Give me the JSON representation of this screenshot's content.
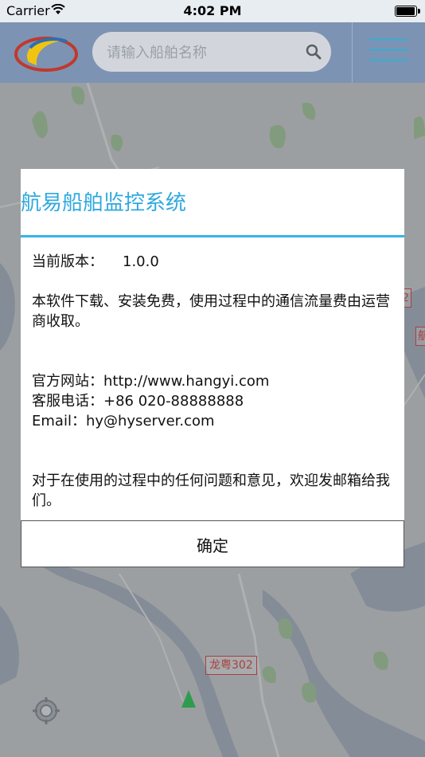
{
  "status_bar": {
    "carrier": "Carrier",
    "time": "4:02 PM"
  },
  "header": {
    "search_placeholder": "请输入船舶名称"
  },
  "dialog": {
    "title": "航易船舶监控系统",
    "version_label": "当前版本：",
    "version_value": "1.0.0",
    "notice": "本软件下载、安装免费，使用过程中的通信流量费由运营商收取。",
    "website": "官方网站：http://www.hangyi.com",
    "phone": "客服电话：+86 020-88888888",
    "email": "Email：hy@hyserver.com",
    "feedback": "对于在使用的过程中的任何问题和意见，欢迎发邮箱给我们。",
    "confirm_label": "确定"
  },
  "map": {
    "road_label_main": "龙粤302",
    "road_label_edge_1": "2",
    "road_label_edge_2": "航"
  },
  "colors": {
    "header_bg": "#7d93b4",
    "accent": "#2fa9df",
    "road_label": "#d9534f",
    "ship_marker": "#2e9c4c"
  },
  "icons": [
    "wifi-icon",
    "battery-icon",
    "app-logo-icon",
    "search-icon",
    "menu-icon",
    "locate-icon",
    "ship-marker-icon"
  ]
}
